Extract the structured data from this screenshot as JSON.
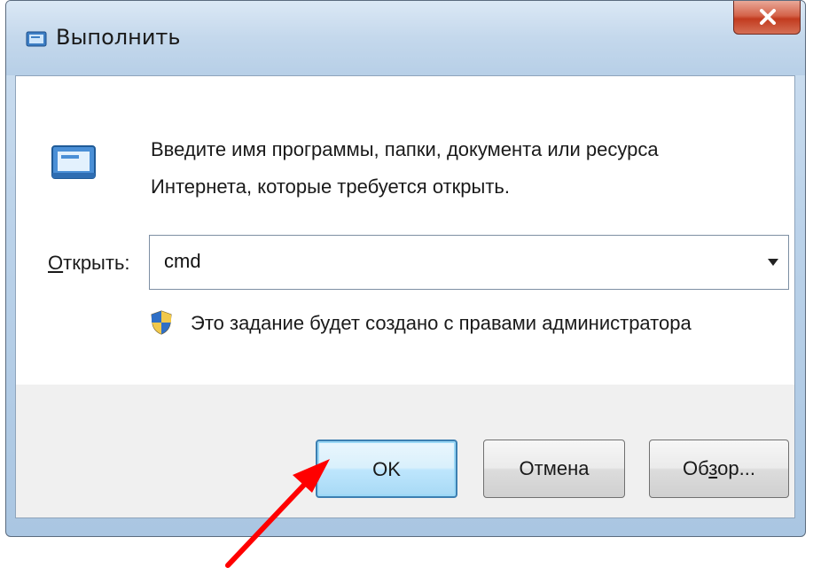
{
  "window": {
    "title": "Выполнить",
    "close_label": "x"
  },
  "content": {
    "description_line1": "Введите имя программы, папки, документа или ресурса",
    "description_line2": "Интернета, которые требуется открыть.",
    "open_label_pre": "О",
    "open_label_rest": "ткрыть:",
    "open_value": "cmd",
    "admin_note": "Это задание будет создано с правами администратора"
  },
  "buttons": {
    "ok": "OK",
    "cancel": "Отмена",
    "browse_pre": "Об",
    "browse_ul": "з",
    "browse_post": "ор..."
  },
  "icons": {
    "title": "run-icon",
    "dialog": "run-icon",
    "shield": "uac-shield-icon",
    "dropdown": "chevron-down-icon",
    "close": "close-icon",
    "annotation": "red-arrow-icon"
  },
  "colors": {
    "annotation_arrow": "#ff0000",
    "close_button": "#c9452b",
    "default_button_border": "#3c7fb1"
  }
}
